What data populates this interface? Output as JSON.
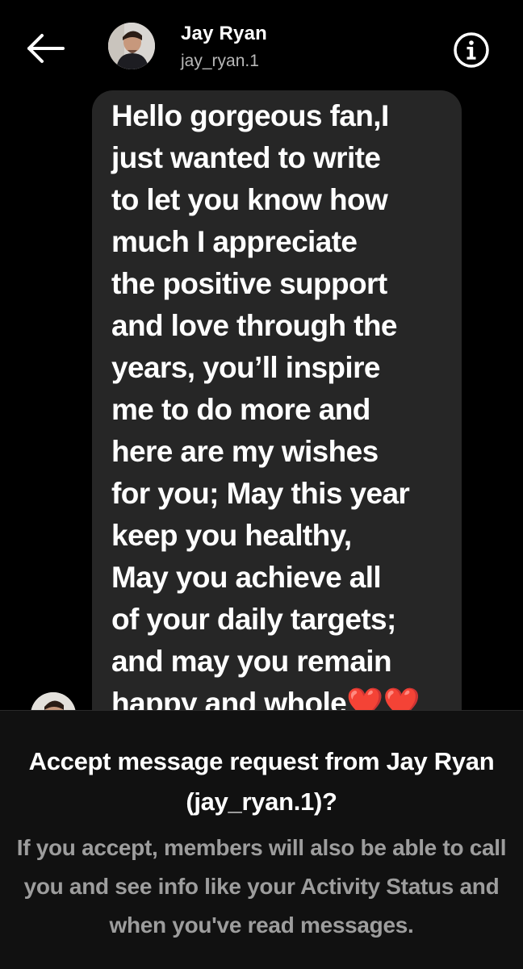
{
  "header": {
    "back_icon": "arrow-left-icon",
    "name": "Jay Ryan",
    "username": "jay_ryan.1",
    "info_icon": "info-circle-icon"
  },
  "message": {
    "text": "Hello gorgeous fan,I\njust wanted to write\nto let you know how\nmuch I appreciate\nthe positive support\nand love through the\nyears, you’ll inspire\nme to do more and\nhere are my wishes\nfor you; May this year\nkeep you healthy,\nMay you achieve all\nof your daily targets;\nand may you remain\nhappy and whole",
    "emoji": "❤️❤️"
  },
  "request": {
    "title": "Accept message request from Jay Ryan (jay_ryan.1)?",
    "description": "If you accept, members will also be able to call you and see info like your Activity Status and when you've read messages."
  },
  "colors": {
    "background": "#000000",
    "bubble": "#262626",
    "panel": "#111111",
    "secondary_text": "#9d9d9d",
    "heart": "#ec1a2c"
  }
}
